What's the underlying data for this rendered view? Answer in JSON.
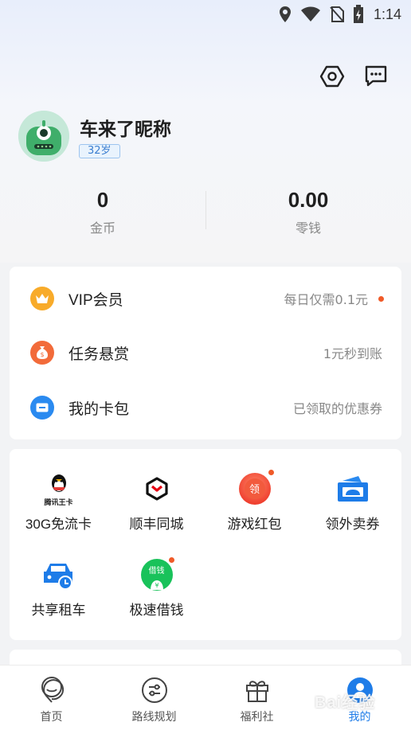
{
  "status_bar": {
    "time": "1:14"
  },
  "profile": {
    "nickname": "车来了昵称",
    "age": "32岁"
  },
  "stats": {
    "coins_value": "0",
    "coins_label": "金币",
    "change_value": "0.00",
    "change_label": "零钱"
  },
  "menu": [
    {
      "label": "VIP会员",
      "sub": "每日仅需0.1元",
      "icon": "crown-icon",
      "color": "#f6a623"
    },
    {
      "label": "任务悬赏",
      "sub": "1元秒到账",
      "icon": "money-bag-icon",
      "color": "#f26b3a"
    },
    {
      "label": "我的卡包",
      "sub": "已领取的优惠券",
      "icon": "card-icon",
      "color": "#2a8af0"
    }
  ],
  "grid": [
    {
      "label": "30G免流卡",
      "icon": "qq-penguin-icon",
      "icon_text": "腾讯王卡"
    },
    {
      "label": "顺丰同城",
      "icon": "sf-logo-icon"
    },
    {
      "label": "游戏红包",
      "icon": "red-envelope-icon",
      "icon_text": "领"
    },
    {
      "label": "领外卖券",
      "icon": "coupon-icon"
    },
    {
      "label": "共享租车",
      "icon": "car-clock-icon"
    },
    {
      "label": "极速借钱",
      "icon": "loan-icon",
      "icon_text": "借钱"
    }
  ],
  "tabs": [
    {
      "label": "首页",
      "icon": "home-icon"
    },
    {
      "label": "路线规划",
      "icon": "route-icon"
    },
    {
      "label": "福利社",
      "icon": "gift-icon"
    },
    {
      "label": "我的",
      "icon": "profile-icon"
    }
  ],
  "watermark": "Bai经验",
  "colors": {
    "accent": "#1e7ce8",
    "red_dot": "#f05a28"
  }
}
